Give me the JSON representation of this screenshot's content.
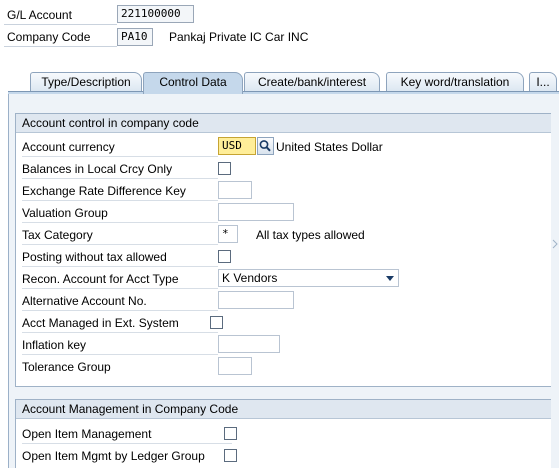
{
  "header": {
    "gl_account_label": "G/L Account",
    "gl_account_value": "221100000",
    "company_code_label": "Company Code",
    "company_code_value": "PA10",
    "company_name": "Pankaj Private IC Car INC"
  },
  "tabs": [
    {
      "label": "Type/Description",
      "active": false
    },
    {
      "label": "Control Data",
      "active": true
    },
    {
      "label": "Create/bank/interest",
      "active": false
    },
    {
      "label": "Key word/translation",
      "active": false
    },
    {
      "label": "I...",
      "active": false
    }
  ],
  "account_control": {
    "title": "Account control in company code",
    "account_currency_label": "Account currency",
    "account_currency_value": "USD",
    "account_currency_text": "United States Dollar",
    "balances_local_label": "Balances in Local Crcy Only",
    "exchange_rate_label": "Exchange Rate Difference Key",
    "valuation_group_label": "Valuation Group",
    "tax_category_label": "Tax Category",
    "tax_category_value": "*",
    "tax_category_text": "All tax types allowed",
    "posting_without_tax_label": "Posting without tax allowed",
    "recon_account_label": "Recon. Account for Acct Type",
    "recon_account_value": "K Vendors",
    "alternative_account_label": "Alternative Account No.",
    "acct_managed_ext_label": "Acct Managed in Ext. System",
    "inflation_key_label": "Inflation key",
    "tolerance_group_label": "Tolerance Group"
  },
  "account_management": {
    "title": "Account Management in Company Code",
    "open_item_mgmt_label": "Open Item Management",
    "open_item_ledger_label": "Open Item Mgmt by Ledger Group"
  },
  "colors": {
    "active_tab": "#c5d8eb",
    "panel_bg": "#eef3f8",
    "required_field": "#ffee99"
  },
  "icons": [
    "search-icon",
    "chevron-down-icon"
  ]
}
